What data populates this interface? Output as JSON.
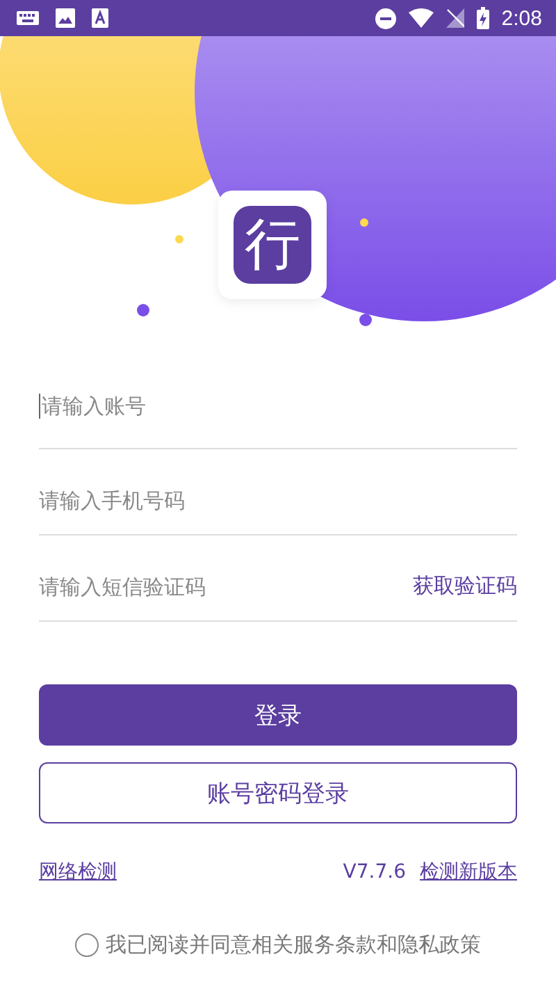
{
  "status_bar": {
    "time": "2:08"
  },
  "logo": {
    "text": "行"
  },
  "fields": [
    {
      "placeholder": "请输入账号",
      "focused": true
    },
    {
      "placeholder": "请输入手机号码",
      "focused": false
    },
    {
      "placeholder": "请输入短信验证码",
      "focused": false,
      "action": "获取验证码"
    }
  ],
  "login_button": "登录",
  "password_login_button": "账号密码登录",
  "footer": {
    "network_check": "网络检测",
    "version": "V7.7.6",
    "check_update": "检测新版本"
  },
  "agreement": {
    "text": "我已阅读并同意相关服务条款和隐私政策",
    "checked": false
  }
}
